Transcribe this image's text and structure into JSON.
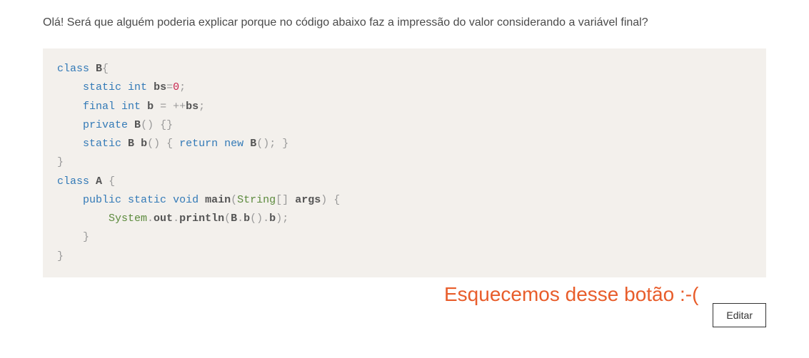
{
  "question": "Olá! Será que alguém poderia explicar porque no código abaixo faz a impressão do valor considerando a variável final?",
  "code": {
    "line1_kw": "class",
    "line1_ident": "B",
    "line1_punct": "{",
    "line2_kw1": "static",
    "line2_kw2": "int",
    "line2_ident": "bs",
    "line2_op": "=",
    "line2_num": "0",
    "line2_punct": ";",
    "line3_kw1": "final",
    "line3_kw2": "int",
    "line3_ident1": "b",
    "line3_op1": "=",
    "line3_op2": "++",
    "line3_ident2": "bs",
    "line3_punct": ";",
    "line4_kw": "private",
    "line4_ident": "B",
    "line4_punct": "() {}",
    "line5_kw": "static",
    "line5_type": "B",
    "line5_ident": "b",
    "line5_punct1": "() {",
    "line5_kw2": "return",
    "line5_kw3": "new",
    "line5_ident2": "B",
    "line5_punct2": "(); }",
    "line6_punct": "}",
    "line7_kw": "class",
    "line7_ident": "A",
    "line7_punct": "{",
    "line8_kw1": "public",
    "line8_kw2": "static",
    "line8_kw3": "void",
    "line8_ident": "main",
    "line8_punct1": "(",
    "line8_type": "String",
    "line8_punct2": "[]",
    "line8_ident2": "args",
    "line8_punct3": ") {",
    "line9_ident1": "System",
    "line9_punct1": ".",
    "line9_ident2": "out",
    "line9_punct2": ".",
    "line9_ident3": "println",
    "line9_punct3": "(",
    "line9_ident4": "B",
    "line9_punct4": ".",
    "line9_ident5": "b",
    "line9_punct5": "().",
    "line9_ident6": "b",
    "line9_punct6": ");",
    "line10_punct": "}",
    "line11_punct": "}"
  },
  "annotation": "Esquecemos desse botão :-(",
  "edit_button": "Editar"
}
